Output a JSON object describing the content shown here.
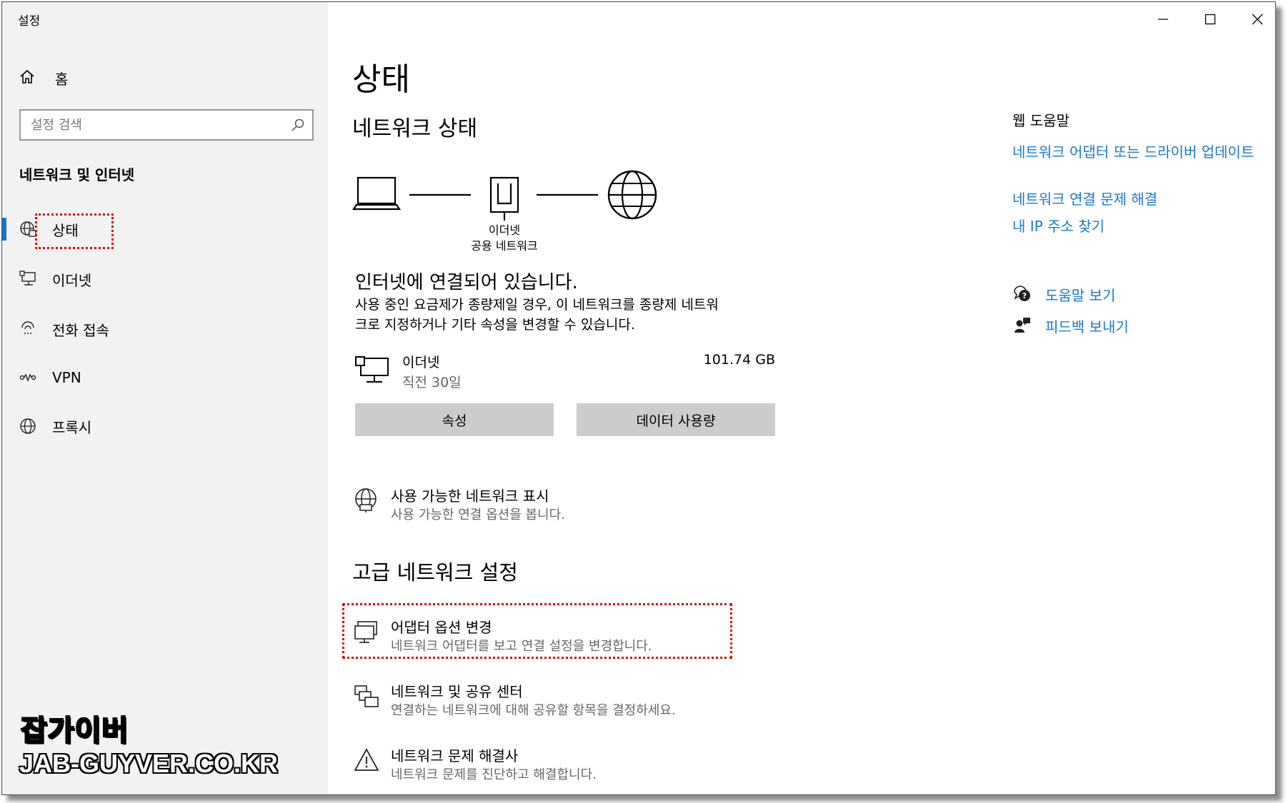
{
  "window": {
    "title": "설정",
    "controls": [
      "minimize",
      "maximize",
      "close"
    ]
  },
  "sidebar": {
    "home_label": "홈",
    "search_placeholder": "설정 검색",
    "section_title": "네트워크 및 인터넷",
    "items": [
      {
        "label": "상태",
        "icon": "globe-status-icon",
        "active": true
      },
      {
        "label": "이더넷",
        "icon": "ethernet-icon",
        "active": false
      },
      {
        "label": "전화 접속",
        "icon": "dialup-icon",
        "active": false
      },
      {
        "label": "VPN",
        "icon": "vpn-icon",
        "active": false
      },
      {
        "label": "프록시",
        "icon": "globe-icon",
        "active": false
      }
    ]
  },
  "main": {
    "page_title": "상태",
    "network_status_heading": "네트워크 상태",
    "diagram": {
      "adapter_label": "이더넷",
      "network_label": "공용 네트워크"
    },
    "connected_text": "인터넷에 연결되어 있습니다.",
    "description_line1": "사용 중인 요금제가 종량제일 경우, 이 네트워크를 종량제 네트워",
    "description_line2": "크로 지정하거나 기타 속성을 변경할 수 있습니다.",
    "connection": {
      "name": "이더넷",
      "period": "직전 30일",
      "usage": "101.74 GB"
    },
    "buttons": {
      "properties": "속성",
      "data_usage": "데이터 사용량"
    },
    "show_networks": {
      "title": "사용 가능한 네트워크 표시",
      "subtitle": "사용 가능한 연결 옵션을 봅니다."
    },
    "advanced_heading": "고급 네트워크 설정",
    "advanced_items": [
      {
        "title": "어댑터 옵션 변경",
        "subtitle": "네트워크 어댑터를 보고 연결 설정을 변경합니다.",
        "icon": "adapter-icon"
      },
      {
        "title": "네트워크 및 공유 센터",
        "subtitle": "연결하는 네트워크에 대해 공유할 항목을 결정하세요.",
        "icon": "sharing-center-icon"
      },
      {
        "title": "네트워크 문제 해결사",
        "subtitle": "네트워크 문제를 진단하고 해결합니다.",
        "icon": "warning-icon"
      }
    ]
  },
  "right_panel": {
    "heading": "웹 도움말",
    "links": [
      "네트워크 어댑터 또는 드라이버 업데이트",
      "네트워크 연결 문제 해결",
      "내 IP 주소 찾기"
    ],
    "help_label": "도움말 보기",
    "feedback_label": "피드백 보내기",
    "link_color": "#1879c9"
  },
  "watermark": {
    "line1": "잡가이버",
    "line2": "JAB-GUYVER.CO.KR"
  },
  "accent_color": "#1a73c9",
  "highlight_color": "#dd0000"
}
